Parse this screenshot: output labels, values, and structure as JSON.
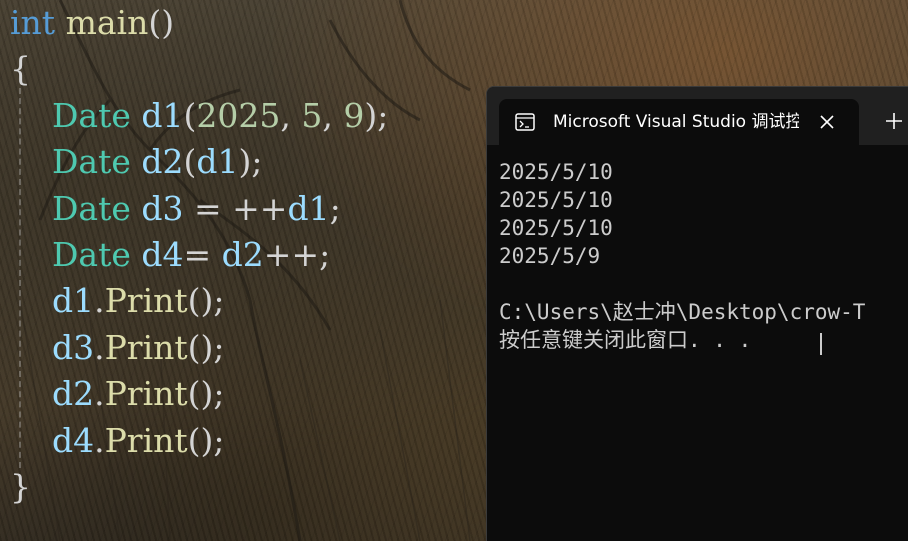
{
  "code": {
    "lines": [
      [
        {
          "t": "int",
          "c": "tok-kw"
        },
        {
          "t": " ",
          "c": "tok-punc"
        },
        {
          "t": "main",
          "c": "tok-fn"
        },
        {
          "t": "()",
          "c": "tok-punc"
        }
      ],
      [
        {
          "t": "{",
          "c": "tok-punc"
        }
      ],
      [
        {
          "t": "    ",
          "c": "tok-punc"
        },
        {
          "t": "Date",
          "c": "tok-type"
        },
        {
          "t": " ",
          "c": "tok-punc"
        },
        {
          "t": "d1",
          "c": "tok-var"
        },
        {
          "t": "(",
          "c": "tok-punc"
        },
        {
          "t": "2025",
          "c": "tok-num"
        },
        {
          "t": ", ",
          "c": "tok-punc"
        },
        {
          "t": "5",
          "c": "tok-num"
        },
        {
          "t": ", ",
          "c": "tok-punc"
        },
        {
          "t": "9",
          "c": "tok-num"
        },
        {
          "t": ");",
          "c": "tok-punc"
        }
      ],
      [
        {
          "t": "    ",
          "c": "tok-punc"
        },
        {
          "t": "Date",
          "c": "tok-type"
        },
        {
          "t": " ",
          "c": "tok-punc"
        },
        {
          "t": "d2",
          "c": "tok-var"
        },
        {
          "t": "(",
          "c": "tok-punc"
        },
        {
          "t": "d1",
          "c": "tok-var"
        },
        {
          "t": ");",
          "c": "tok-punc"
        }
      ],
      [
        {
          "t": "    ",
          "c": "tok-punc"
        },
        {
          "t": "Date",
          "c": "tok-type"
        },
        {
          "t": " ",
          "c": "tok-punc"
        },
        {
          "t": "d3",
          "c": "tok-var"
        },
        {
          "t": " = ++",
          "c": "tok-punc"
        },
        {
          "t": "d1",
          "c": "tok-var"
        },
        {
          "t": ";",
          "c": "tok-punc"
        }
      ],
      [
        {
          "t": "    ",
          "c": "tok-punc"
        },
        {
          "t": "Date",
          "c": "tok-type"
        },
        {
          "t": " ",
          "c": "tok-punc"
        },
        {
          "t": "d4",
          "c": "tok-var"
        },
        {
          "t": "= ",
          "c": "tok-punc"
        },
        {
          "t": "d2",
          "c": "tok-var"
        },
        {
          "t": "++;",
          "c": "tok-punc"
        }
      ],
      [
        {
          "t": "    ",
          "c": "tok-punc"
        },
        {
          "t": "d1",
          "c": "tok-var"
        },
        {
          "t": ".",
          "c": "tok-punc"
        },
        {
          "t": "Print",
          "c": "tok-fn"
        },
        {
          "t": "();",
          "c": "tok-punc"
        }
      ],
      [
        {
          "t": "    ",
          "c": "tok-punc"
        },
        {
          "t": "d3",
          "c": "tok-var"
        },
        {
          "t": ".",
          "c": "tok-punc"
        },
        {
          "t": "Print",
          "c": "tok-fn"
        },
        {
          "t": "();",
          "c": "tok-punc"
        }
      ],
      [
        {
          "t": "    ",
          "c": "tok-punc"
        },
        {
          "t": "d2",
          "c": "tok-var"
        },
        {
          "t": ".",
          "c": "tok-punc"
        },
        {
          "t": "Print",
          "c": "tok-fn"
        },
        {
          "t": "();",
          "c": "tok-punc"
        }
      ],
      [
        {
          "t": "    ",
          "c": "tok-punc"
        },
        {
          "t": "d4",
          "c": "tok-var"
        },
        {
          "t": ".",
          "c": "tok-punc"
        },
        {
          "t": "Print",
          "c": "tok-fn"
        },
        {
          "t": "();",
          "c": "tok-punc"
        }
      ],
      [
        {
          "t": "}",
          "c": "tok-punc"
        }
      ]
    ]
  },
  "terminal": {
    "tab_title": "Microsoft Visual Studio 调试控",
    "tab_icon": "console-icon",
    "close_icon": "close-icon",
    "new_tab_icon": "plus-icon",
    "output": [
      "2025/5/10",
      "2025/5/10",
      "2025/5/10",
      "2025/5/9",
      "",
      "C:\\Users\\赵士冲\\Desktop\\crow-T",
      "按任意键关闭此窗口. . ."
    ]
  },
  "colors": {
    "keyword": "#569cd6",
    "function": "#dcdcaa",
    "type": "#4ec9b0",
    "variable": "#9cdcfe",
    "number": "#b5cea8",
    "terminal_bg": "#0c0c0c",
    "terminal_text": "#cccccc"
  }
}
